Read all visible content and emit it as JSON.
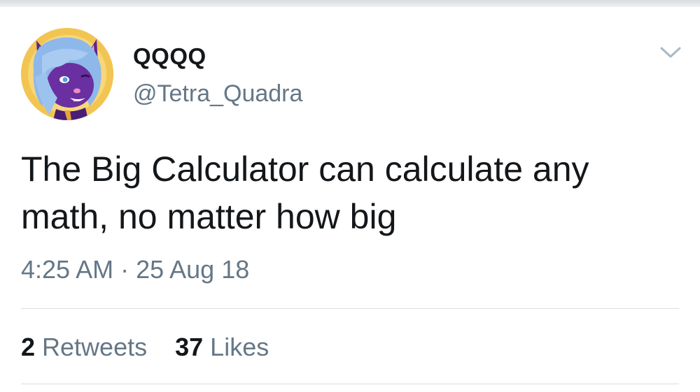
{
  "tweet": {
    "display_name": "QQQQ",
    "handle": "@Tetra_Quadra",
    "text": "The Big Calculator can calculate any math, no matter how big",
    "timestamp": "4:25 AM · 25 Aug 18",
    "retweets_count": "2",
    "retweets_label": "Retweets",
    "likes_count": "37",
    "likes_label": "Likes"
  },
  "icons": {
    "menu": "chevron-down-icon",
    "avatar": "avatar-image"
  },
  "colors": {
    "text_primary": "#14171a",
    "text_secondary": "#657786",
    "divider": "#dadde0",
    "avatar_background": "#f2c552",
    "avatar_fur": "#6a2fa0",
    "avatar_hair": "#8fb8ea"
  }
}
